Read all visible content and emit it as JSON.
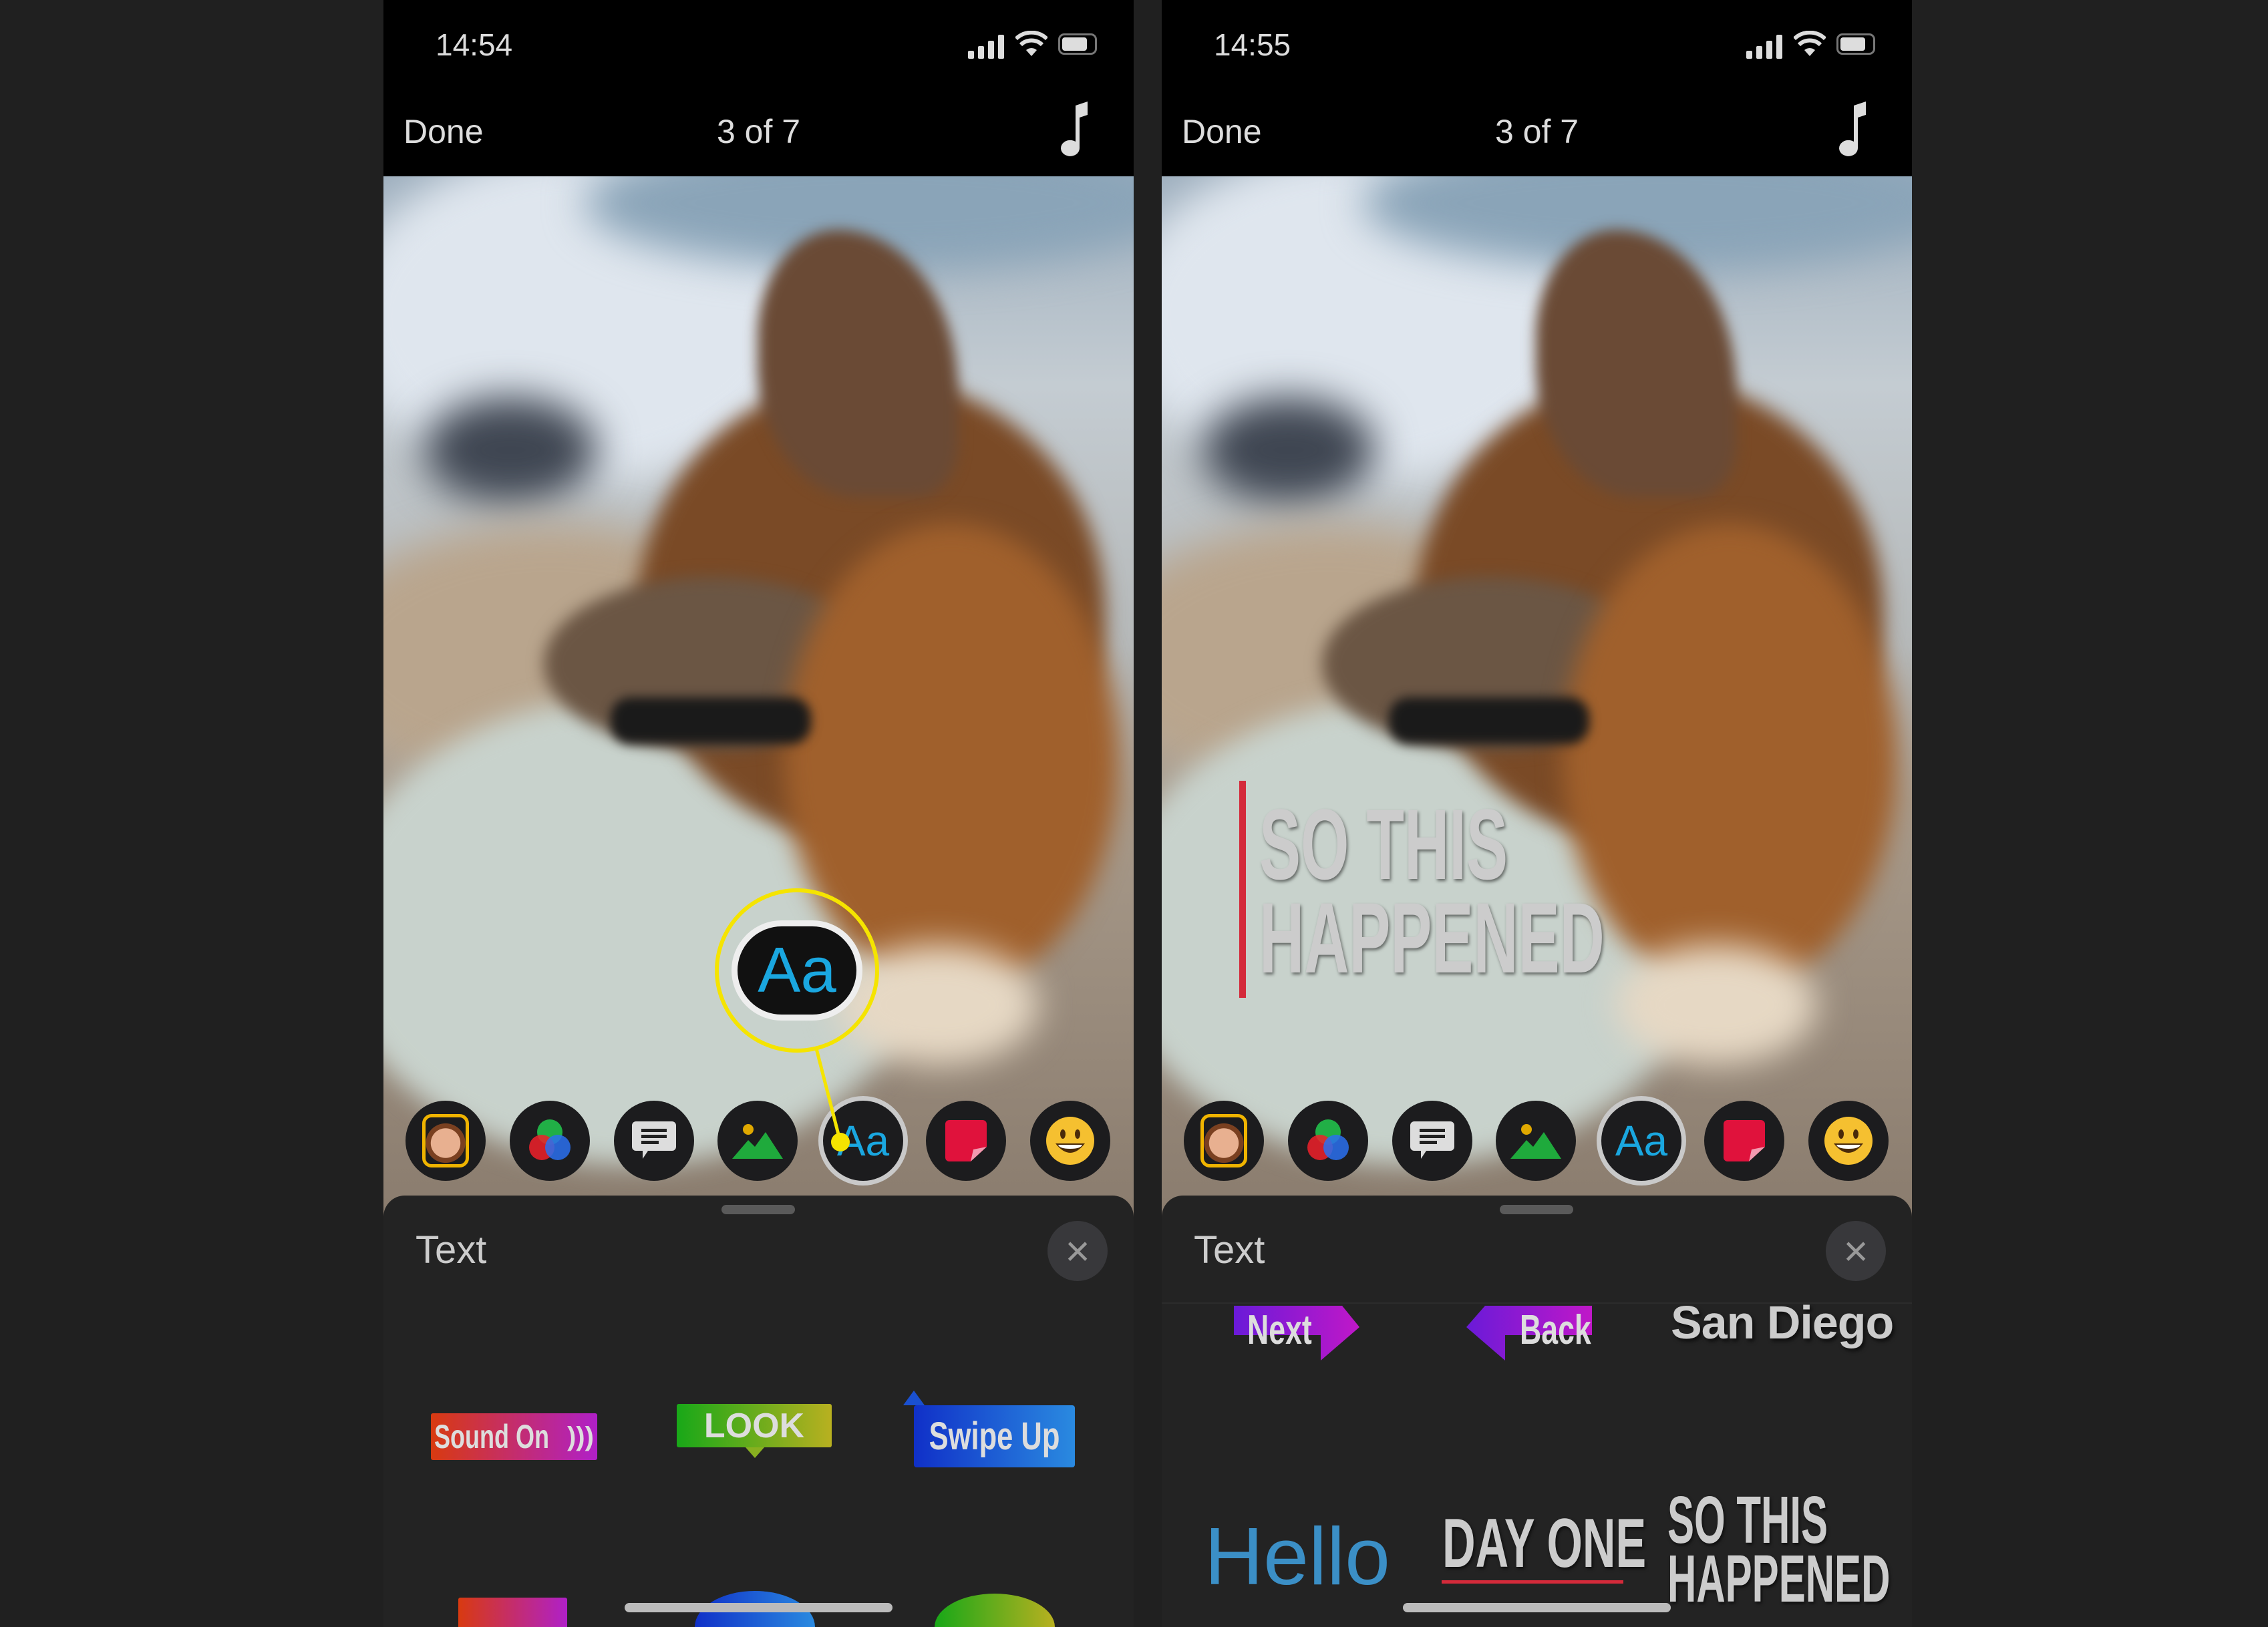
{
  "phones": [
    {
      "status": {
        "time": "14:54"
      },
      "nav": {
        "done": "Done",
        "count": "3 of 7",
        "music_icon": "music-note-icon"
      },
      "sheet": {
        "title": "Text",
        "close_icon": "close-icon"
      }
    },
    {
      "status": {
        "time": "14:55"
      },
      "nav": {
        "done": "Done",
        "count": "3 of 7",
        "music_icon": "music-note-icon"
      },
      "sheet": {
        "title": "Text",
        "close_icon": "close-icon"
      }
    }
  ],
  "toolbar": [
    "memoji",
    "filters",
    "speech-bubble",
    "shapes",
    "text",
    "stickers",
    "emoji"
  ],
  "callout": {
    "label": "Aa",
    "color": "#f5e400"
  },
  "left_stickers": {
    "sound_on": "Sound On",
    "look": "LOOK",
    "swipe_up": "Swipe Up"
  },
  "right_overlay": {
    "line1": "SO THIS",
    "line2": "HAPPENED"
  },
  "right_stickers": {
    "next": "Next",
    "back": "Back",
    "san_diego": "San Diego",
    "hello": "Hello",
    "day_one": "DAY ONE",
    "so_this": "SO THIS",
    "happened": "HAPPENED"
  },
  "colors": {
    "accent_blue": "#1aa7e0",
    "hello_blue": "#3b8fc6",
    "red": "#d42a3a",
    "purple": "#8a2be2"
  }
}
